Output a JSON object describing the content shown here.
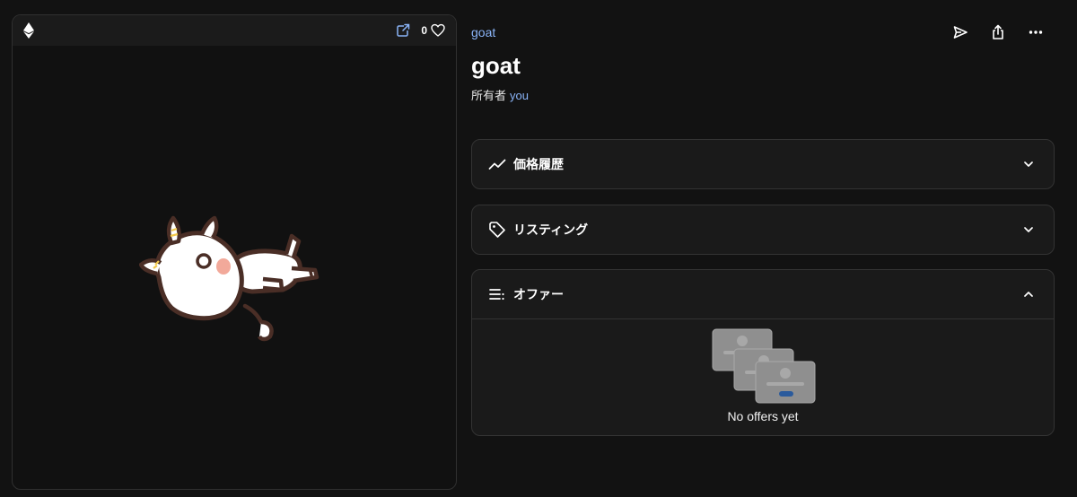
{
  "media": {
    "chain_icon": "ethereum-icon",
    "external_link_icon": "external-link-icon",
    "favorite_count": "0",
    "favorite_icon": "heart-icon",
    "image_subject": "goat"
  },
  "header": {
    "collection_name": "goat",
    "actions": [
      {
        "icon": "send-icon"
      },
      {
        "icon": "share-icon"
      },
      {
        "icon": "more-icon"
      }
    ]
  },
  "item": {
    "title": "goat",
    "owner_prefix": "所有者",
    "owner_name": "you"
  },
  "panels": {
    "price_history": {
      "label": "価格履歴",
      "icon": "trend-line-icon",
      "expanded": false
    },
    "listings": {
      "label": "リスティング",
      "icon": "tag-icon",
      "expanded": false
    },
    "offers": {
      "label": "オファー",
      "icon": "list-icon",
      "expanded": true,
      "empty_text": "No offers yet"
    }
  },
  "colors": {
    "background": "#121212",
    "panel_bg": "#1a1a1a",
    "border": "#333333",
    "link": "#8ab4f8",
    "accent_blue": "#2a5a9c"
  }
}
